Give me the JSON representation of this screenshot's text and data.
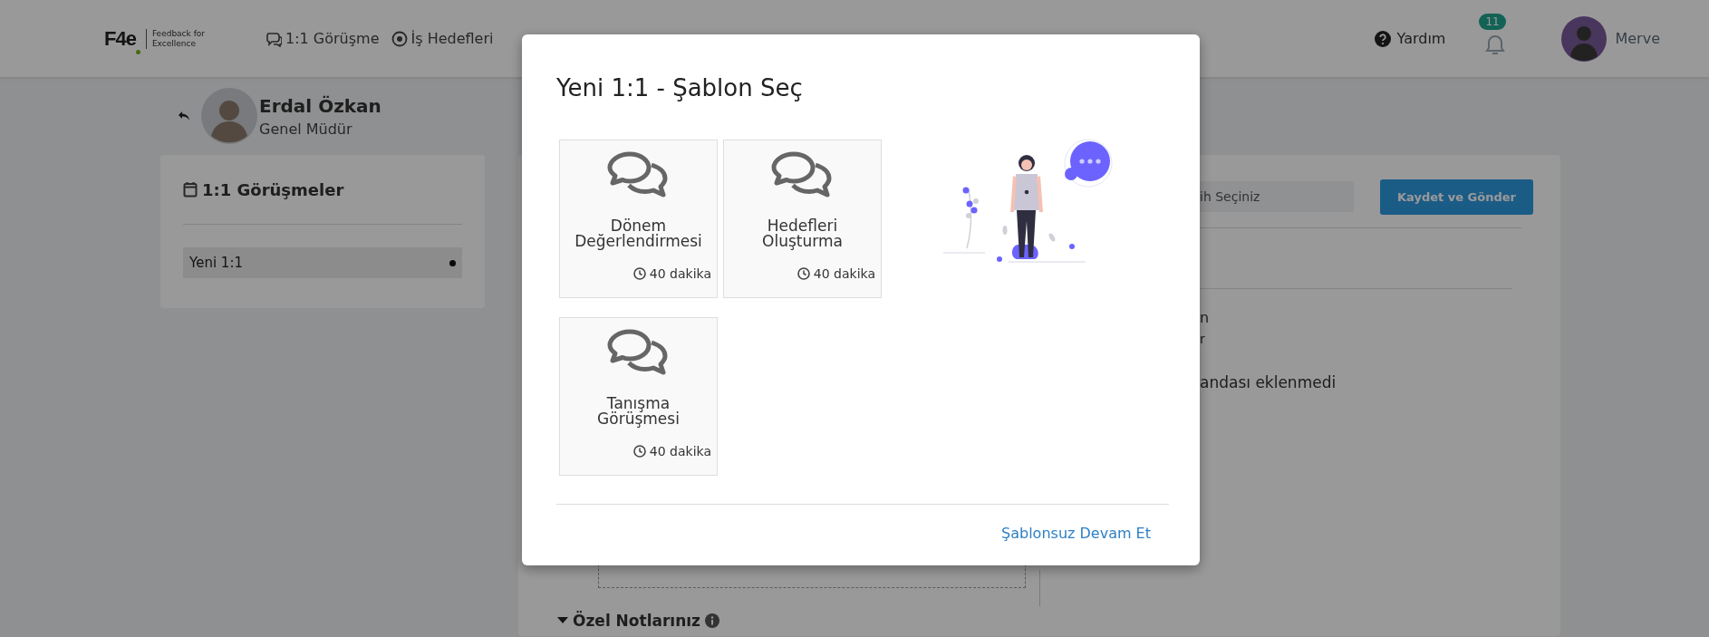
{
  "header": {
    "logo": {
      "mark": "F4e",
      "tagline": "Feedback for Excellence"
    },
    "nav": [
      {
        "label": "1:1 Görüşme"
      },
      {
        "label": "İş Hedefleri"
      }
    ],
    "help": "Yardım",
    "notifications": {
      "count": "11"
    },
    "user": {
      "name": "Merve"
    }
  },
  "profile": {
    "name": "Erdal Özkan",
    "title": "Genel Müdür"
  },
  "meetings_panel": {
    "title": "1:1 Görüşmeler",
    "items": [
      {
        "label": "Yeni 1:1",
        "selected": true
      }
    ]
  },
  "main_panel": {
    "date_field": {
      "placeholder": "ih Seçiniz"
    },
    "save_button": "Kaydet ve Gönder",
    "texts": [
      "n",
      "r",
      "andası eklenmedi"
    ],
    "notes_heading": "Özel Notlarınız",
    "notes_expanded": true
  },
  "modal": {
    "title": "Yeni 1:1 - Şablon Seç",
    "templates": [
      {
        "title": "Dönem Değerlendirmesi",
        "duration": "40 dakika"
      },
      {
        "title": "Hedefleri Oluşturma",
        "duration": "40 dakika"
      },
      {
        "title": "Tanışma Görüşmesi",
        "duration": "40 dakika"
      }
    ],
    "continue_link": "Şablonsuz Devam Et"
  }
}
